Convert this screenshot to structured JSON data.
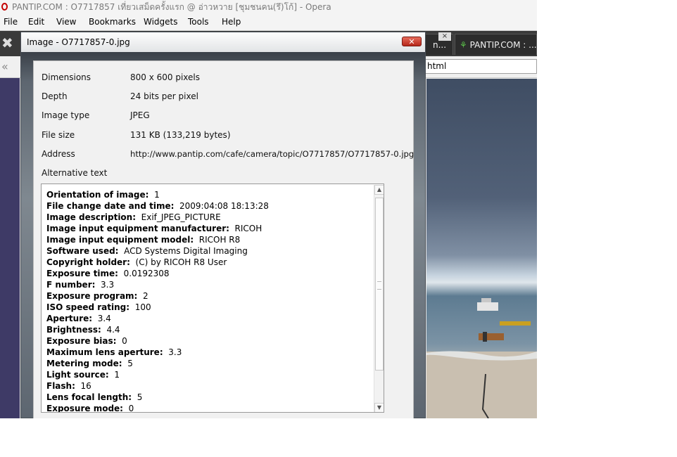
{
  "window": {
    "title": "PANTIP.COM : O7717857 เที่ยวเสม็ดครั้งแรก @ อ่าวหวาย [ชุมชนคน(รึ)โก้] - Opera"
  },
  "menu": {
    "items": [
      "File",
      "Edit",
      "View",
      "Bookmarks",
      "Widgets",
      "Tools",
      "Help"
    ]
  },
  "tabs": [
    {
      "label": "n..."
    },
    {
      "label": "PANTIP.COM : ..."
    }
  ],
  "tab_close_label": "×",
  "address_bar": {
    "value": "html"
  },
  "icons": {
    "tools": "wrench-icon",
    "back": "rewind-icon",
    "close": "close-icon",
    "scroll_up": "up-arrow-icon",
    "scroll_down": "down-arrow-icon"
  },
  "dialog": {
    "title": "Image - O7717857-0.jpg",
    "close_label": "✕",
    "properties": [
      {
        "label": "Dimensions",
        "value": "800 x 600 pixels"
      },
      {
        "label": "Depth",
        "value": "24 bits per pixel"
      },
      {
        "label": "Image type",
        "value": "JPEG"
      },
      {
        "label": "File size",
        "value": "131 KB (133,219 bytes)"
      },
      {
        "label": "Address",
        "value": "http://www.pantip.com/cafe/camera/topic/O7717857/O7717857-0.jpg"
      }
    ],
    "alt_text_label": "Alternative text",
    "exif": [
      {
        "key": "Orientation of image:",
        "value": "1"
      },
      {
        "key": "File change date and time:",
        "value": "2009:04:08 18:13:28"
      },
      {
        "key": "Image description:",
        "value": "Exif_JPEG_PICTURE"
      },
      {
        "key": "Image input equipment manufacturer:",
        "value": "RICOH"
      },
      {
        "key": "Image input equipment model:",
        "value": "RICOH R8"
      },
      {
        "key": "Software used:",
        "value": "ACD Systems Digital Imaging"
      },
      {
        "key": "Copyright holder:",
        "value": "(C) by RICOH R8 User"
      },
      {
        "key": "Exposure time:",
        "value": "0.0192308"
      },
      {
        "key": "F number:",
        "value": "3.3"
      },
      {
        "key": "Exposure program:",
        "value": "2"
      },
      {
        "key": "ISO speed rating:",
        "value": "100"
      },
      {
        "key": "Aperture:",
        "value": "3.4"
      },
      {
        "key": "Brightness:",
        "value": "4.4"
      },
      {
        "key": "Exposure bias:",
        "value": "0"
      },
      {
        "key": "Maximum lens aperture:",
        "value": "3.3"
      },
      {
        "key": "Metering mode:",
        "value": "5"
      },
      {
        "key": "Light source:",
        "value": "1"
      },
      {
        "key": "Flash:",
        "value": "16"
      },
      {
        "key": "Lens focal length:",
        "value": "5"
      },
      {
        "key": "Exposure mode:",
        "value": "0"
      }
    ]
  },
  "colors": {
    "sidebar": "#3e3a66",
    "tab_bar": "#3a3a3a",
    "close_button": "#c94a3a"
  }
}
